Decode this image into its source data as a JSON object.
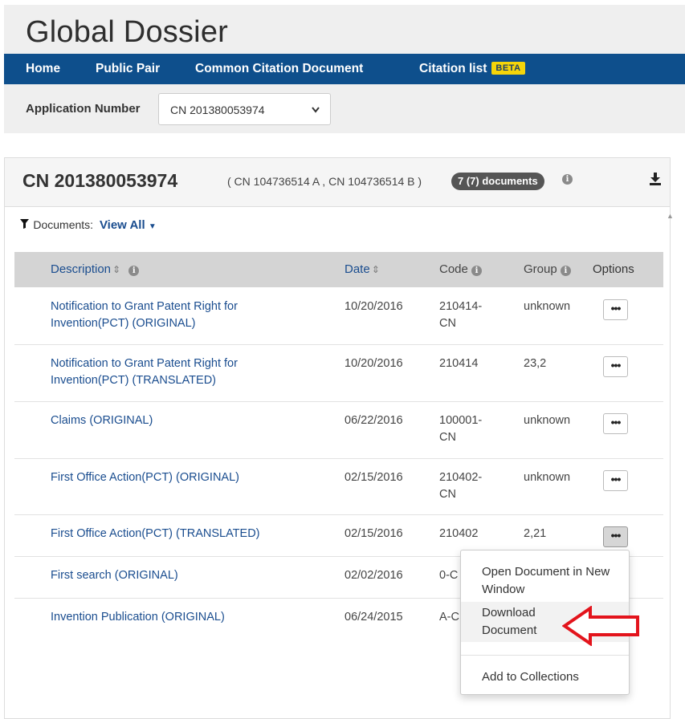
{
  "app": {
    "title": "Global Dossier"
  },
  "nav": {
    "items": [
      "Home",
      "Public Pair",
      "Common Citation Document",
      "Citation list"
    ],
    "beta_badge": "BETA"
  },
  "application_selector": {
    "label": "Application Number",
    "value": "CN 201380053974"
  },
  "panel": {
    "application_id": "CN 201380053974",
    "publications": "( CN 104736514 A , CN 104736514 B )",
    "documents_badge": "7 (7) documents"
  },
  "filter": {
    "label": "Documents:",
    "value": "View All"
  },
  "table": {
    "columns": [
      "Description",
      "Date",
      "Code",
      "Group",
      "Options"
    ],
    "rows": [
      {
        "description": "Notification to Grant Patent Right for Invention(PCT) (ORIGINAL)",
        "date": "10/20/2016",
        "code": "210414-CN",
        "group": "unknown"
      },
      {
        "description": "Notification to Grant Patent Right for Invention(PCT) (TRANSLATED)",
        "date": "10/20/2016",
        "code": "210414",
        "group": "23,2"
      },
      {
        "description": "Claims (ORIGINAL)",
        "date": "06/22/2016",
        "code": "100001-CN",
        "group": "unknown"
      },
      {
        "description": "First Office Action(PCT) (ORIGINAL)",
        "date": "02/15/2016",
        "code": "210402-CN",
        "group": "unknown"
      },
      {
        "description": "First Office Action(PCT) (TRANSLATED)",
        "date": "02/15/2016",
        "code": "210402",
        "group": "2,21"
      },
      {
        "description": "First search (ORIGINAL)",
        "date": "02/02/2016",
        "code": "0-C",
        "group": ""
      },
      {
        "description": "Invention Publication (ORIGINAL)",
        "date": "06/24/2015",
        "code": "A-C",
        "group": ""
      }
    ],
    "options_glyph": "•••"
  },
  "context_menu": {
    "items": [
      "Open Document in New Window",
      "Download Document",
      "Add to Collections"
    ]
  },
  "colors": {
    "navbar": "#0e4f8c",
    "link": "#1a4d8f",
    "beta": "#f5d50a",
    "arrow": "#e3141c"
  },
  "icons": [
    "chevron-down-icon",
    "info-icon",
    "download-icon",
    "filter-icon",
    "sort-icon",
    "arrow-annotation-icon"
  ]
}
